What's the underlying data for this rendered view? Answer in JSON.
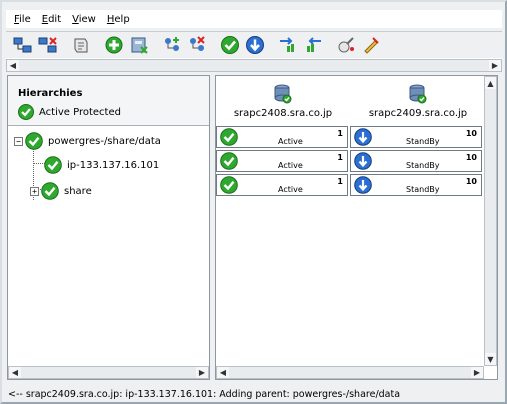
{
  "menubar": {
    "items": [
      {
        "label": "File",
        "mnemonic": "F",
        "rest": "ile"
      },
      {
        "label": "Edit",
        "mnemonic": "E",
        "rest": "dit"
      },
      {
        "label": "View",
        "mnemonic": "V",
        "rest": "iew"
      },
      {
        "label": "Help",
        "mnemonic": "H",
        "rest": "elp"
      }
    ]
  },
  "toolbar": {
    "buttons": [
      "connect-servers-icon",
      "disconnect-servers-icon",
      "properties-icon",
      "create-resource-icon",
      "extend-resource-icon",
      "add-dependency-icon",
      "remove-dependency-icon",
      "in-service-icon",
      "out-of-service-icon",
      "switchover-icon",
      "switchback-icon",
      "view-log-icon",
      "edit-properties-icon"
    ]
  },
  "colors": {
    "active_green": "#2fa82f",
    "standby_blue": "#2a6fd1",
    "panel_border": "#8e98a2"
  },
  "hierarchies": {
    "title": "Hierarchies",
    "status": "Active Protected",
    "tree": [
      {
        "label": "powergres-/share/data",
        "expanded": true
      },
      {
        "label": "ip-133.137.16.101"
      },
      {
        "label": "share",
        "expanded": false
      }
    ]
  },
  "servers": [
    {
      "name": "srapc2408.sra.co.jp"
    },
    {
      "name": "srapc2409.sra.co.jp"
    }
  ],
  "grid": {
    "rows": [
      [
        {
          "state": "Active",
          "priority": "1"
        },
        {
          "state": "StandBy",
          "priority": "10"
        }
      ],
      [
        {
          "state": "Active",
          "priority": "1"
        },
        {
          "state": "StandBy",
          "priority": "10"
        }
      ],
      [
        {
          "state": "Active",
          "priority": "1"
        },
        {
          "state": "StandBy",
          "priority": "10"
        }
      ]
    ]
  },
  "statusbar": {
    "message": "<-- srapc2409.sra.co.jp: ip-133.137.16.101: Adding parent: powergres-/share/data"
  }
}
